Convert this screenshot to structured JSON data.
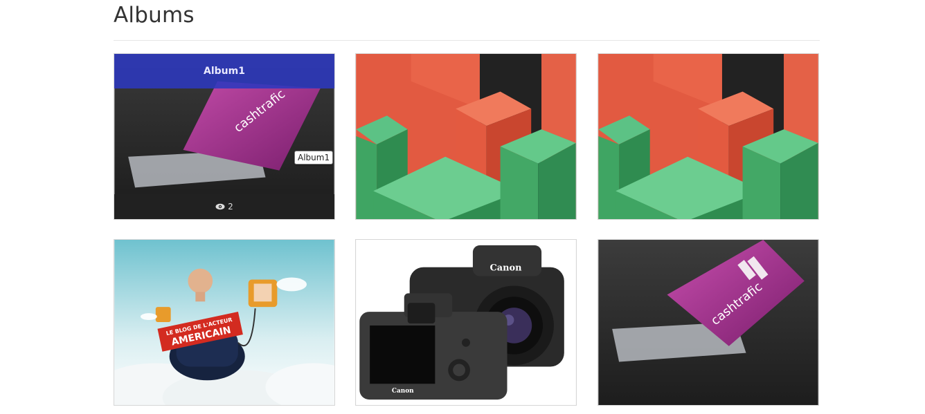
{
  "page": {
    "title": "Albums"
  },
  "albums": [
    {
      "name": "Album1",
      "views": "2",
      "tooltip": "Album1",
      "image": "business-card-photo"
    },
    {
      "image": "green-red-blocks"
    },
    {
      "image": "green-red-blocks"
    },
    {
      "image": "le-blog-de-l-acteur-americain-poster",
      "poster_text_1": "LE BLOG DE L'ACTEUR",
      "poster_text_2": "AMERICAIN"
    },
    {
      "image": "canon-cameras-photo",
      "brand": "Canon"
    },
    {
      "image": "business-card-photo"
    }
  ],
  "card_text": "cashtrafic",
  "icons": {
    "views": "eye-icon"
  },
  "colors": {
    "album_header": "#2c38be",
    "album_footer": "#222222",
    "card_magenta": "#9b2d8a",
    "block_green": "#4caf6e",
    "block_red": "#e0533d"
  }
}
